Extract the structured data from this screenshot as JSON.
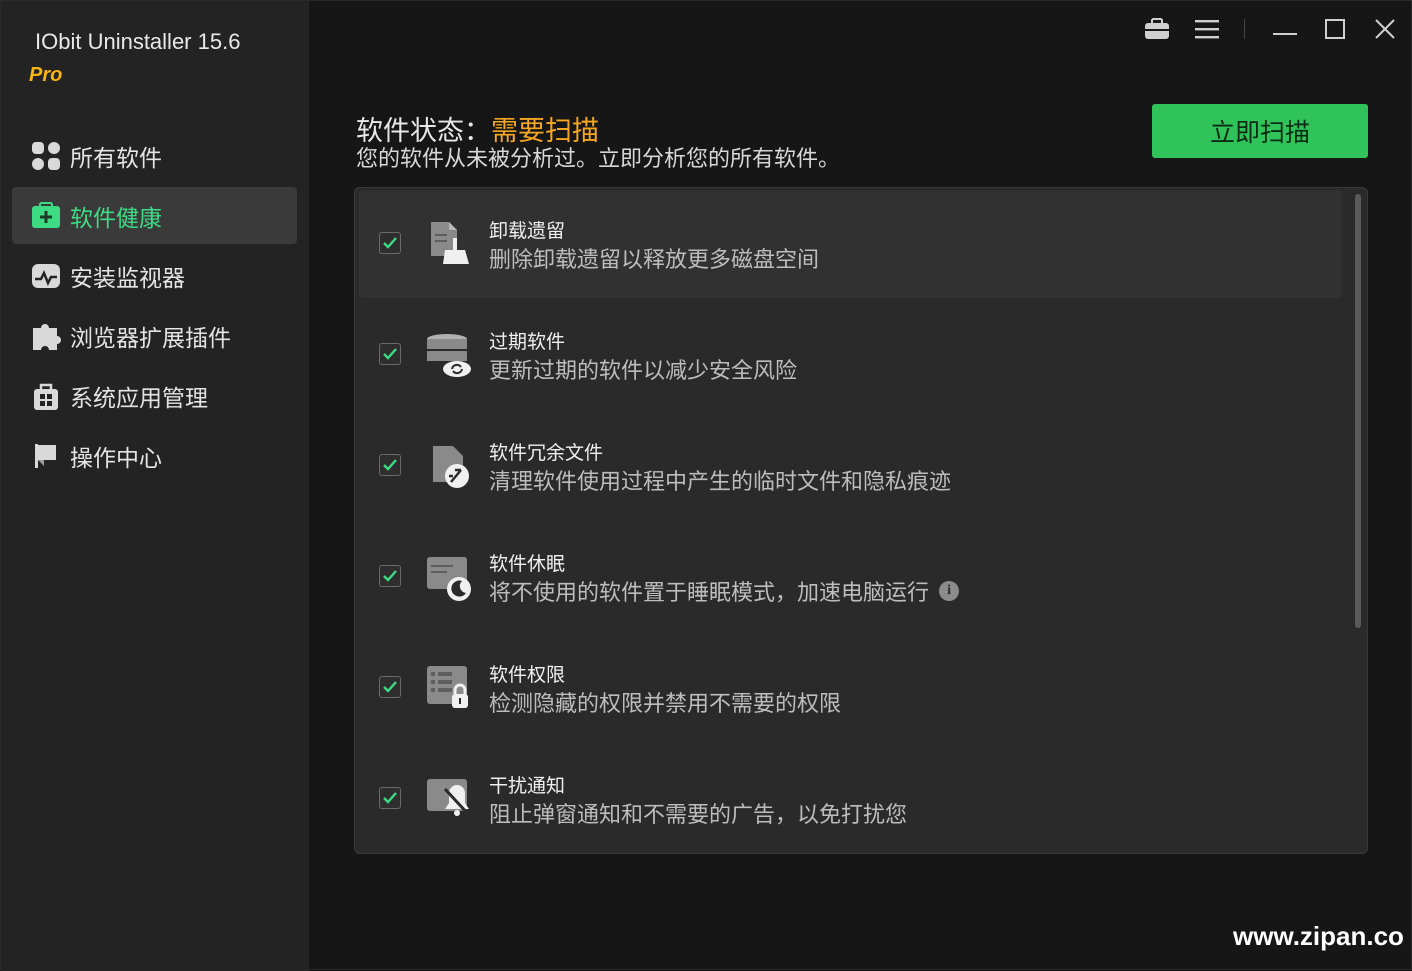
{
  "app": {
    "title": "IObit Uninstaller 15.6",
    "edition": "Pro"
  },
  "sidebar": {
    "items": [
      {
        "label": "所有软件",
        "icon": "grid-apps-icon",
        "active": false
      },
      {
        "label": "软件健康",
        "icon": "health-kit-icon",
        "active": true
      },
      {
        "label": "安装监视器",
        "icon": "monitor-pulse-icon",
        "active": false
      },
      {
        "label": "浏览器扩展插件",
        "icon": "puzzle-piece-icon",
        "active": false
      },
      {
        "label": "系统应用管理",
        "icon": "windows-bag-icon",
        "active": false
      },
      {
        "label": "操作中心",
        "icon": "flag-icon",
        "active": false
      }
    ]
  },
  "titlebar": {
    "icons": [
      "toolbox-icon",
      "menu-icon",
      "minimize-icon",
      "maximize-icon",
      "close-icon"
    ]
  },
  "main": {
    "status_label": "软件状态：",
    "status_value": "需要扫描",
    "status_desc": "您的软件从未被分析过。立即分析您的所有软件。",
    "scan_button": "立即扫描"
  },
  "items": [
    {
      "title": "卸载遗留",
      "desc": "删除卸载遗留以释放更多磁盘空间",
      "icon": "leftover-broom-icon",
      "checked": true,
      "info": false
    },
    {
      "title": "过期软件",
      "desc": "更新过期的软件以减少安全风险",
      "icon": "outdated-update-icon",
      "checked": true,
      "info": false
    },
    {
      "title": "软件冗余文件",
      "desc": "清理软件使用过程中产生的临时文件和隐私痕迹",
      "icon": "junk-clean-icon",
      "checked": true,
      "info": false
    },
    {
      "title": "软件休眠",
      "desc": "将不使用的软件置于睡眠模式，加速电脑运行",
      "icon": "sleep-moon-icon",
      "checked": true,
      "info": true
    },
    {
      "title": "软件权限",
      "desc": "检测隐藏的权限并禁用不需要的权限",
      "icon": "permission-lock-icon",
      "checked": true,
      "info": false
    },
    {
      "title": "干扰通知",
      "desc": "阻止弹窗通知和不需要的广告，以免打扰您",
      "icon": "bell-off-icon",
      "checked": true,
      "info": false
    }
  ],
  "watermark": "www.zipan.co",
  "colors": {
    "accent_green": "#2fc35a",
    "active_label": "#3ddc84",
    "status_orange": "#f5a623",
    "edition_gold": "#f5b516"
  }
}
